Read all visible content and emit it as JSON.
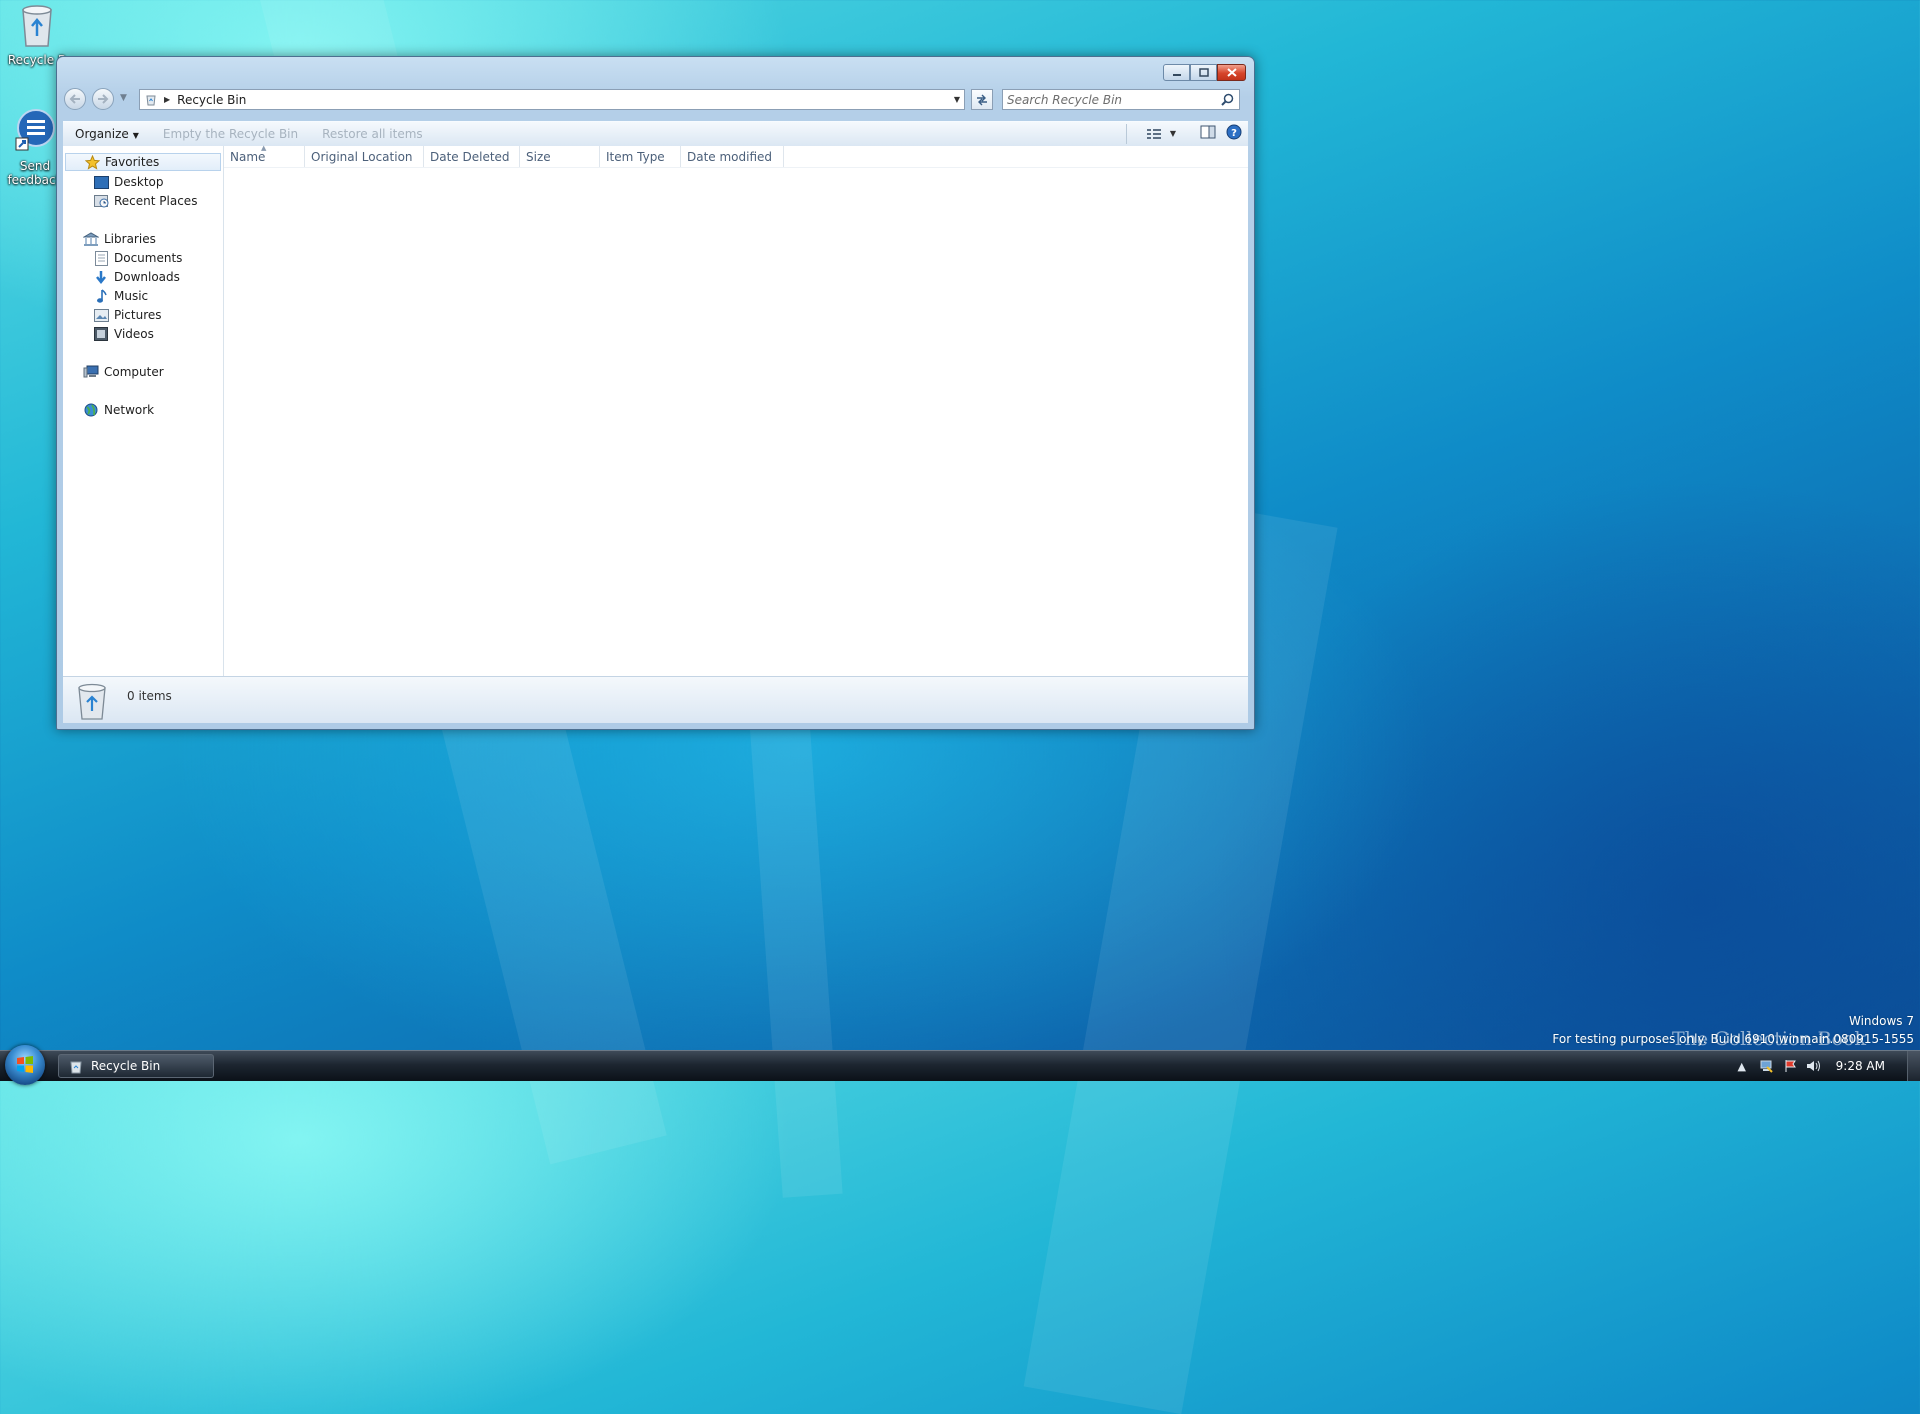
{
  "desktop": {
    "icons": [
      {
        "label": "Recycle B"
      },
      {
        "label": "Send feedback"
      }
    ]
  },
  "window": {
    "address": {
      "location": "Recycle Bin"
    },
    "search": {
      "placeholder": "Search Recycle Bin"
    },
    "toolbar": {
      "organize": "Organize",
      "empty": "Empty the Recycle Bin",
      "restore": "Restore all items"
    },
    "nav": {
      "favorites": {
        "label": "Favorites",
        "items": [
          {
            "label": "Desktop"
          },
          {
            "label": "Recent Places"
          }
        ]
      },
      "libraries": {
        "label": "Libraries",
        "items": [
          {
            "label": "Documents"
          },
          {
            "label": "Downloads"
          },
          {
            "label": "Music"
          },
          {
            "label": "Pictures"
          },
          {
            "label": "Videos"
          }
        ]
      },
      "computer": {
        "label": "Computer"
      },
      "network": {
        "label": "Network"
      }
    },
    "columns": [
      "Name",
      "Original Location",
      "Date Deleted",
      "Size",
      "Item Type",
      "Date modified"
    ],
    "details": {
      "count": "0 items"
    }
  },
  "taskbar": {
    "button_label": "Recycle Bin",
    "clock": "9:28 AM"
  },
  "watermark": {
    "line1": "Windows 7",
    "line2": "For testing purposes only. Build 6910.winmain.080915-1555",
    "brand": "The Collection Book"
  },
  "colors": {
    "close_button": "#d6452a",
    "window_frame": "#b4cfe8",
    "taskbar": "#1d2631"
  }
}
